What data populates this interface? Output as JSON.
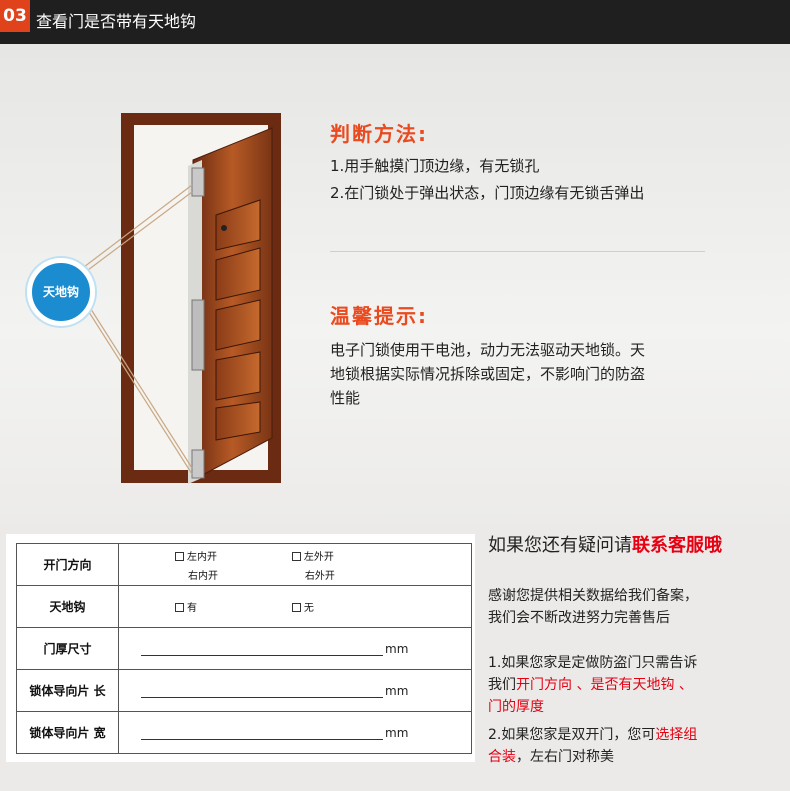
{
  "header": {
    "number": "03",
    "title": "查看门是否带有天地钩"
  },
  "badge": {
    "label": "天地钩"
  },
  "method": {
    "title": "判断方法:",
    "items": [
      "1.用手触摸门顶边缘，有无锁孔",
      "2.在门锁处于弹出状态，门顶边缘有无锁舌弹出"
    ]
  },
  "tip": {
    "title": "温馨提示:",
    "lines": [
      "电子门锁使用干电池，动力无法驱动天地锁。天",
      "地锁根据实际情况拆除或固定，不影响门的防盗",
      "性能"
    ]
  },
  "form": {
    "rows": [
      {
        "label": "开门方向",
        "options": [
          "左内开",
          "左外开",
          "右内开",
          "右外开"
        ]
      },
      {
        "label": "天地钩",
        "options": [
          "有",
          "无"
        ]
      },
      {
        "label": "门厚尺寸",
        "unit": "mm"
      },
      {
        "label": "锁体导向片 长",
        "unit": "mm"
      },
      {
        "label": "锁体导向片 宽",
        "unit": "mm"
      }
    ]
  },
  "contact": {
    "heading_prefix": "如果您还有疑问请",
    "heading_highlight": "联系客服哦",
    "thanks": [
      "感谢您提供相关数据给我们备案，",
      "我们会不断改进努力完善售后"
    ],
    "note1": {
      "prefix": "1.如果您家是定做防盗门只需告诉",
      "line2_prefix": "我们",
      "highlight1": "开门方向 、是否有天地钩 、",
      "highlight2": "门的厚度"
    },
    "note2": {
      "prefix": "2.如果您家是双开门，您可",
      "highlight1": "选择组",
      "highlight2": "合装",
      "suffix": "，左右门对称美"
    }
  },
  "colors": {
    "accent": "#e94a1f",
    "badge": "#1b8cd0",
    "header": "#1f1f1f",
    "highlight": "#e60012"
  }
}
